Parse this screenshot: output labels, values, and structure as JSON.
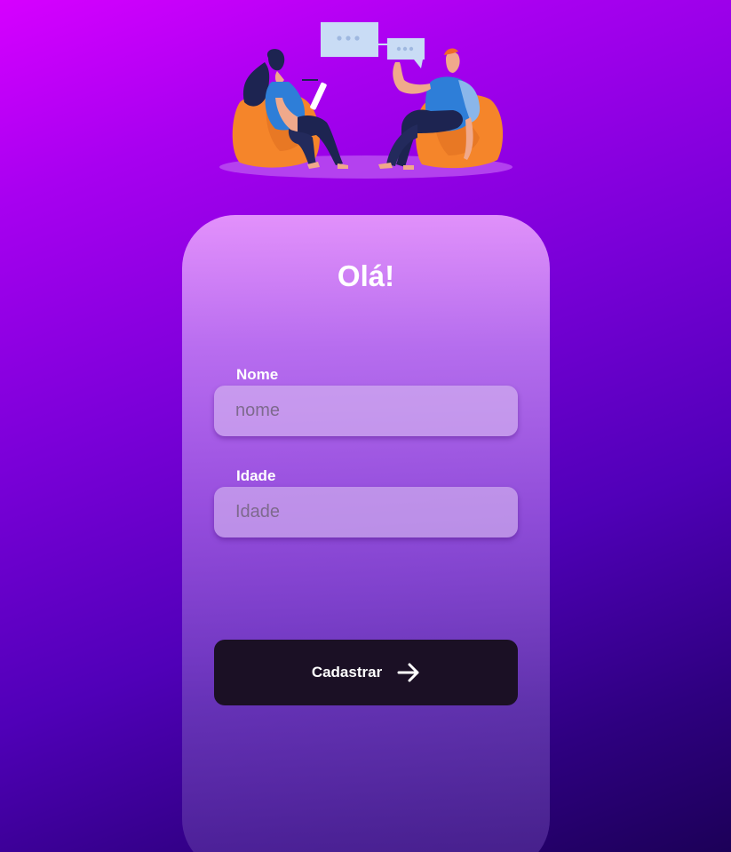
{
  "icons": {
    "illustration": "two-people-chatting-illustration",
    "button": "arrow-right-icon"
  },
  "colors": {
    "button_background": "#1b1025",
    "text": "#ffffff"
  },
  "card": {
    "title": "Olá!"
  },
  "form": {
    "name": {
      "label": "Nome",
      "placeholder": "nome",
      "value": ""
    },
    "age": {
      "label": "Idade",
      "placeholder": "Idade",
      "value": ""
    },
    "submit_label": "Cadastrar"
  }
}
